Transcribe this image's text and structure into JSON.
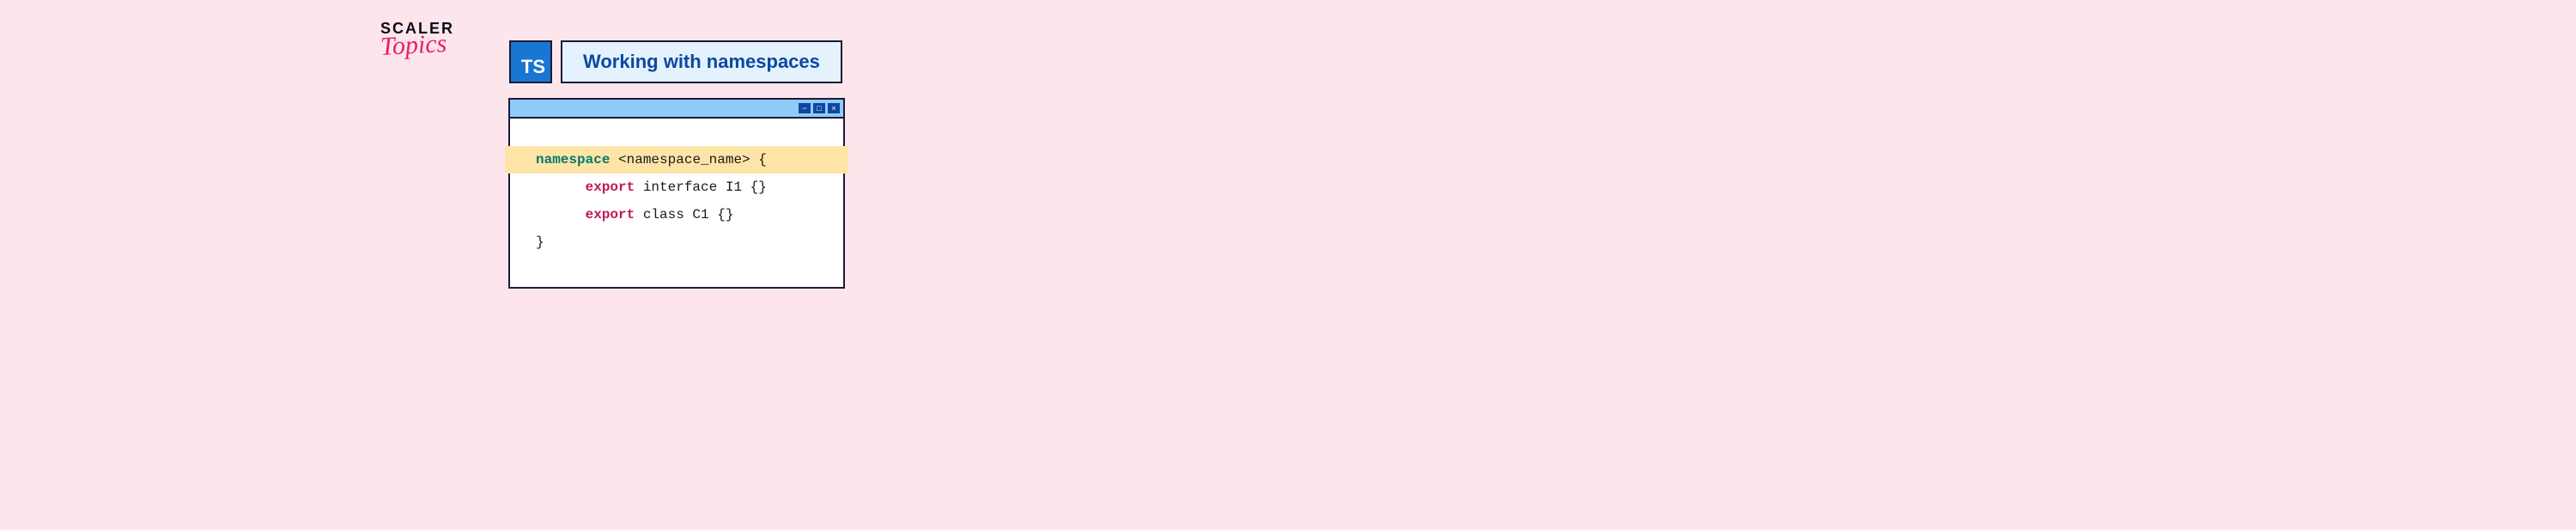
{
  "logo": {
    "line1": "SCALER",
    "line2": "Topics"
  },
  "badge": "TS",
  "title": "Working with namespaces",
  "window_controls": {
    "min": "−",
    "max": "□",
    "close": "×"
  },
  "code": {
    "kw_namespace": "namespace",
    "ns_placeholder": " <namespace_name> {",
    "kw_export1": "export",
    "interface_decl": " interface I1 {}",
    "kw_export2": "export",
    "class_decl": " class C1 {}",
    "close": "}"
  }
}
